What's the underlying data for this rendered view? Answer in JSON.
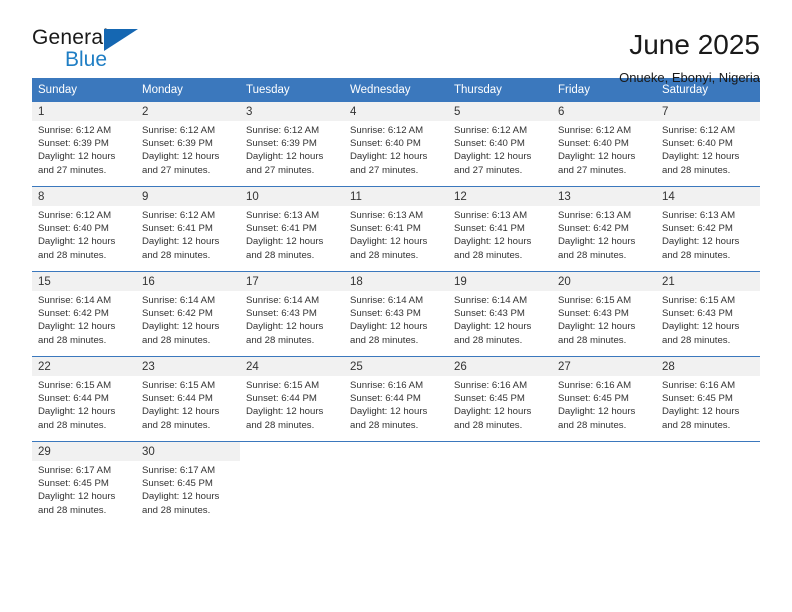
{
  "brand": {
    "name_part1": "General",
    "name_part2": "Blue",
    "accent_color": "#1567b2",
    "logo_icon": "triangle-icon"
  },
  "header": {
    "month_title": "June 2025",
    "location": "Onueke, Ebonyi, Nigeria"
  },
  "calendar": {
    "header_color": "#3b78bd",
    "weekdays": [
      "Sunday",
      "Monday",
      "Tuesday",
      "Wednesday",
      "Thursday",
      "Friday",
      "Saturday"
    ],
    "weeks": [
      [
        {
          "day": "1",
          "sunrise": "Sunrise: 6:12 AM",
          "sunset": "Sunset: 6:39 PM",
          "daylight": "Daylight: 12 hours and 27 minutes."
        },
        {
          "day": "2",
          "sunrise": "Sunrise: 6:12 AM",
          "sunset": "Sunset: 6:39 PM",
          "daylight": "Daylight: 12 hours and 27 minutes."
        },
        {
          "day": "3",
          "sunrise": "Sunrise: 6:12 AM",
          "sunset": "Sunset: 6:39 PM",
          "daylight": "Daylight: 12 hours and 27 minutes."
        },
        {
          "day": "4",
          "sunrise": "Sunrise: 6:12 AM",
          "sunset": "Sunset: 6:40 PM",
          "daylight": "Daylight: 12 hours and 27 minutes."
        },
        {
          "day": "5",
          "sunrise": "Sunrise: 6:12 AM",
          "sunset": "Sunset: 6:40 PM",
          "daylight": "Daylight: 12 hours and 27 minutes."
        },
        {
          "day": "6",
          "sunrise": "Sunrise: 6:12 AM",
          "sunset": "Sunset: 6:40 PM",
          "daylight": "Daylight: 12 hours and 27 minutes."
        },
        {
          "day": "7",
          "sunrise": "Sunrise: 6:12 AM",
          "sunset": "Sunset: 6:40 PM",
          "daylight": "Daylight: 12 hours and 28 minutes."
        }
      ],
      [
        {
          "day": "8",
          "sunrise": "Sunrise: 6:12 AM",
          "sunset": "Sunset: 6:40 PM",
          "daylight": "Daylight: 12 hours and 28 minutes."
        },
        {
          "day": "9",
          "sunrise": "Sunrise: 6:12 AM",
          "sunset": "Sunset: 6:41 PM",
          "daylight": "Daylight: 12 hours and 28 minutes."
        },
        {
          "day": "10",
          "sunrise": "Sunrise: 6:13 AM",
          "sunset": "Sunset: 6:41 PM",
          "daylight": "Daylight: 12 hours and 28 minutes."
        },
        {
          "day": "11",
          "sunrise": "Sunrise: 6:13 AM",
          "sunset": "Sunset: 6:41 PM",
          "daylight": "Daylight: 12 hours and 28 minutes."
        },
        {
          "day": "12",
          "sunrise": "Sunrise: 6:13 AM",
          "sunset": "Sunset: 6:41 PM",
          "daylight": "Daylight: 12 hours and 28 minutes."
        },
        {
          "day": "13",
          "sunrise": "Sunrise: 6:13 AM",
          "sunset": "Sunset: 6:42 PM",
          "daylight": "Daylight: 12 hours and 28 minutes."
        },
        {
          "day": "14",
          "sunrise": "Sunrise: 6:13 AM",
          "sunset": "Sunset: 6:42 PM",
          "daylight": "Daylight: 12 hours and 28 minutes."
        }
      ],
      [
        {
          "day": "15",
          "sunrise": "Sunrise: 6:14 AM",
          "sunset": "Sunset: 6:42 PM",
          "daylight": "Daylight: 12 hours and 28 minutes."
        },
        {
          "day": "16",
          "sunrise": "Sunrise: 6:14 AM",
          "sunset": "Sunset: 6:42 PM",
          "daylight": "Daylight: 12 hours and 28 minutes."
        },
        {
          "day": "17",
          "sunrise": "Sunrise: 6:14 AM",
          "sunset": "Sunset: 6:43 PM",
          "daylight": "Daylight: 12 hours and 28 minutes."
        },
        {
          "day": "18",
          "sunrise": "Sunrise: 6:14 AM",
          "sunset": "Sunset: 6:43 PM",
          "daylight": "Daylight: 12 hours and 28 minutes."
        },
        {
          "day": "19",
          "sunrise": "Sunrise: 6:14 AM",
          "sunset": "Sunset: 6:43 PM",
          "daylight": "Daylight: 12 hours and 28 minutes."
        },
        {
          "day": "20",
          "sunrise": "Sunrise: 6:15 AM",
          "sunset": "Sunset: 6:43 PM",
          "daylight": "Daylight: 12 hours and 28 minutes."
        },
        {
          "day": "21",
          "sunrise": "Sunrise: 6:15 AM",
          "sunset": "Sunset: 6:43 PM",
          "daylight": "Daylight: 12 hours and 28 minutes."
        }
      ],
      [
        {
          "day": "22",
          "sunrise": "Sunrise: 6:15 AM",
          "sunset": "Sunset: 6:44 PM",
          "daylight": "Daylight: 12 hours and 28 minutes."
        },
        {
          "day": "23",
          "sunrise": "Sunrise: 6:15 AM",
          "sunset": "Sunset: 6:44 PM",
          "daylight": "Daylight: 12 hours and 28 minutes."
        },
        {
          "day": "24",
          "sunrise": "Sunrise: 6:15 AM",
          "sunset": "Sunset: 6:44 PM",
          "daylight": "Daylight: 12 hours and 28 minutes."
        },
        {
          "day": "25",
          "sunrise": "Sunrise: 6:16 AM",
          "sunset": "Sunset: 6:44 PM",
          "daylight": "Daylight: 12 hours and 28 minutes."
        },
        {
          "day": "26",
          "sunrise": "Sunrise: 6:16 AM",
          "sunset": "Sunset: 6:45 PM",
          "daylight": "Daylight: 12 hours and 28 minutes."
        },
        {
          "day": "27",
          "sunrise": "Sunrise: 6:16 AM",
          "sunset": "Sunset: 6:45 PM",
          "daylight": "Daylight: 12 hours and 28 minutes."
        },
        {
          "day": "28",
          "sunrise": "Sunrise: 6:16 AM",
          "sunset": "Sunset: 6:45 PM",
          "daylight": "Daylight: 12 hours and 28 minutes."
        }
      ],
      [
        {
          "day": "29",
          "sunrise": "Sunrise: 6:17 AM",
          "sunset": "Sunset: 6:45 PM",
          "daylight": "Daylight: 12 hours and 28 minutes."
        },
        {
          "day": "30",
          "sunrise": "Sunrise: 6:17 AM",
          "sunset": "Sunset: 6:45 PM",
          "daylight": "Daylight: 12 hours and 28 minutes."
        },
        {
          "day": "",
          "sunrise": "",
          "sunset": "",
          "daylight": ""
        },
        {
          "day": "",
          "sunrise": "",
          "sunset": "",
          "daylight": ""
        },
        {
          "day": "",
          "sunrise": "",
          "sunset": "",
          "daylight": ""
        },
        {
          "day": "",
          "sunrise": "",
          "sunset": "",
          "daylight": ""
        },
        {
          "day": "",
          "sunrise": "",
          "sunset": "",
          "daylight": ""
        }
      ]
    ]
  }
}
